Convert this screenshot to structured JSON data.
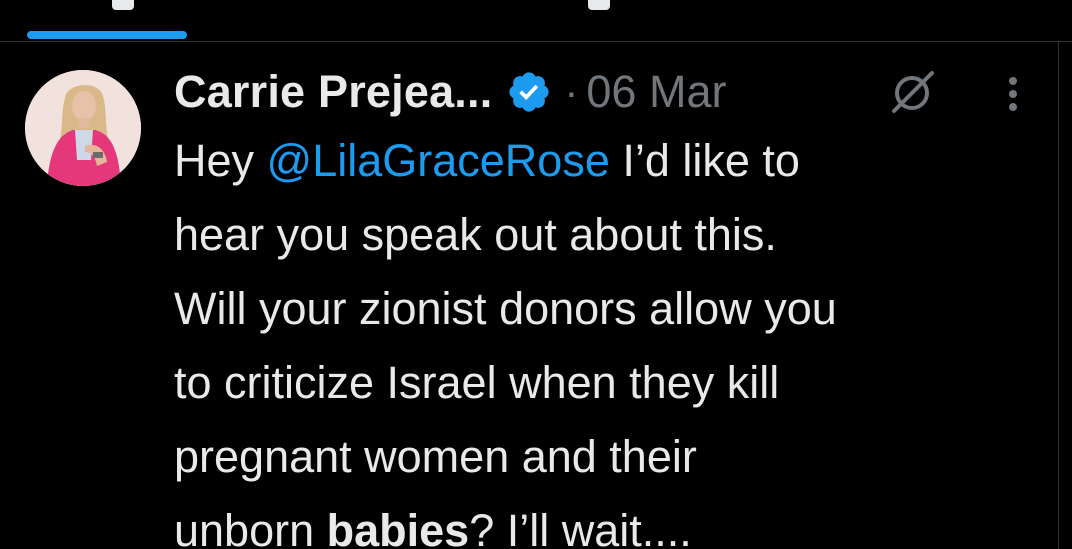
{
  "tweet": {
    "author_name": "Carrie Prejea...",
    "separator": "·",
    "date": "06 Mar",
    "lines": [
      {
        "pre": "Hey ",
        "mention": "@LilaGraceRose",
        "post": " I’d like to"
      },
      {
        "text": "hear you speak out about this."
      },
      {
        "text": "Will your zionist donors allow you"
      },
      {
        "text": "to criticize Israel when they kill"
      },
      {
        "text": "pregnant women and their"
      },
      {
        "pre": "unborn ",
        "bold": "babies",
        "post": "? I’ll wait...."
      }
    ]
  },
  "colors": {
    "background": "#000000",
    "text": "#e7e9ea",
    "muted": "#71767b",
    "accent": "#1d9bf0"
  },
  "icons": {
    "verified": "verified-badge-icon",
    "grok": "grok-icon",
    "more": "more-vertical-icon"
  }
}
